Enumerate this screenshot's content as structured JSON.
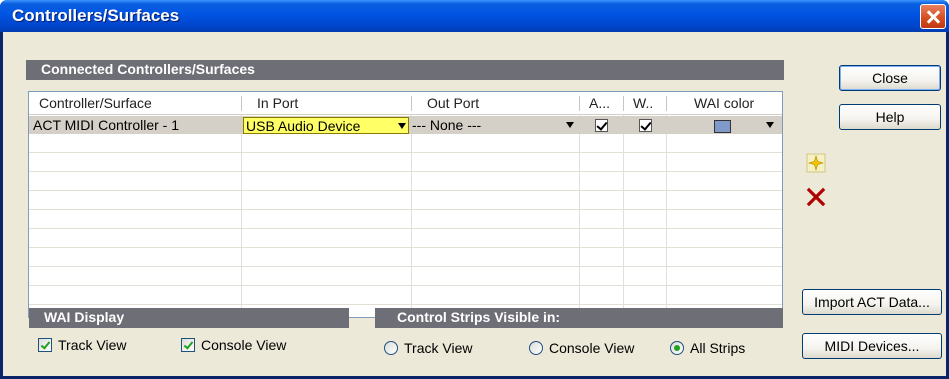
{
  "window": {
    "title": "Controllers/Surfaces"
  },
  "connected": {
    "section_title": "Connected Controllers/Surfaces",
    "columns": [
      "Controller/Surface",
      "In Port",
      "Out Port",
      "A...",
      "W..",
      "WAI color"
    ],
    "rows": [
      {
        "controller": "ACT MIDI Controller - 1",
        "in_port": "USB Audio Device",
        "out_port": "--- None ---",
        "a_checked": true,
        "w_checked": true,
        "wai_color": "#7f99c8"
      }
    ]
  },
  "wai_display": {
    "section_title": "WAI Display",
    "track_view_label": "Track View",
    "track_view_checked": true,
    "console_view_label": "Console View",
    "console_view_checked": true
  },
  "strips": {
    "section_title": "Control Strips Visible in:",
    "options": [
      "Track View",
      "Console View",
      "All Strips"
    ],
    "selected": "All Strips"
  },
  "buttons": {
    "close": "Close",
    "help": "Help",
    "import_act": "Import ACT Data...",
    "midi_devices": "MIDI Devices..."
  },
  "icons": {
    "add": "add-controller-icon",
    "delete": "delete-controller-icon",
    "title_close": "close-icon"
  }
}
